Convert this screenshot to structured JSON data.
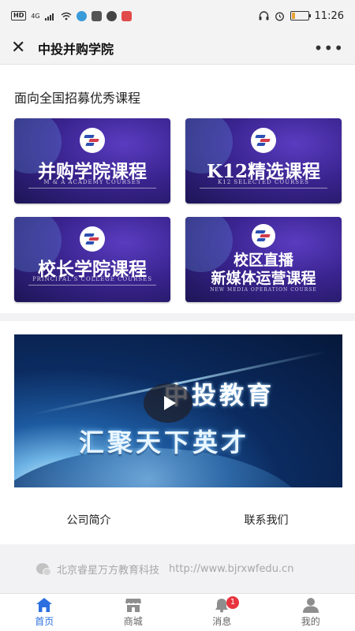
{
  "status_bar": {
    "hd": "HD",
    "net": "4G",
    "time": "11:26",
    "battery_level": 0.2
  },
  "title_bar": {
    "title": "中投并购学院"
  },
  "section_heading": "面向全国招募优秀课程",
  "courses": [
    {
      "title": "并购学院课程",
      "subtitle": "M & A ACADEMY COURSES"
    },
    {
      "title": "K12精选课程",
      "subtitle": "K12 SELECTED COURSES"
    },
    {
      "title": "校长学院课程",
      "subtitle": "PRINCIPAL'S COLLEGE COURSES"
    },
    {
      "title_line1": "校区直播",
      "title_line2": "新媒体运营课程",
      "subtitle": "NEW MEDIA OPERATION COURSE"
    }
  ],
  "video": {
    "headline": "中投教育",
    "slogan": "汇聚天下英才"
  },
  "links": {
    "company_intro": "公司简介",
    "contact_us": "联系我们"
  },
  "footer": {
    "company": "北京睿星万方教育科技",
    "url": "http://www.bjrxwfedu.cn"
  },
  "tabs": [
    {
      "label": "首页",
      "icon": "home-icon",
      "active": true
    },
    {
      "label": "商城",
      "icon": "store-icon"
    },
    {
      "label": "消息",
      "icon": "bell-icon",
      "badge": "1"
    },
    {
      "label": "我的",
      "icon": "user-icon"
    }
  ],
  "colors": {
    "accent": "#2b6fe0",
    "card_purple": "#3a2490",
    "badge_red": "#e8323c"
  }
}
